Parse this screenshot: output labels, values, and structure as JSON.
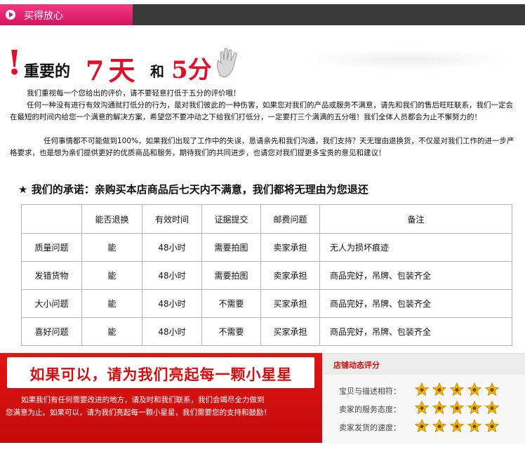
{
  "header": {
    "tab_label": "买得放心"
  },
  "title": {
    "exclaim": "!",
    "part1": "重要的",
    "part2": "7天",
    "part3": "和",
    "part4": "5分"
  },
  "paragraphs": {
    "p1": "我们重视每一个您给出的评价，请不要轻意打低于五分的评价哦！",
    "p2": "任何一种没有进行有效沟通就打低分的行为，是对我们彼此的一种伤害，如果您对我们的产品或服务不满意，请先和我们的售后旺旺联系，我们一定会在最短的时间内给您一个满意的解决方案，希望您不要冲动之下给我们打低分，一定要打三个满满的五分哦！我们全体人员都会为止不懈努力的！",
    "p3": "任何事情都不可能做到100%，如果我们出现了工作中的失误，恳请亲先和我们沟通，我们支持？天无理由退换货，不仅是对我们工作的进一步严格要求，也是想为亲们提供更好的优质商品和服务，期待我们的共同进步，也请您对我们提更多宝贵的意见和建议！"
  },
  "promise": {
    "star": "★",
    "text": "我们的承诺：亲购买本店商品后七天内不满意，我们都将无理由为您退还"
  },
  "table": {
    "headers": [
      "",
      "能否退换",
      "有效时间",
      "证据提交",
      "邮费问题",
      "备注"
    ],
    "rows": [
      [
        "质量问题",
        "能",
        "48小时",
        "需要拍图",
        "卖家承担",
        "无人为损坏痕迹"
      ],
      [
        "发错货物",
        "能",
        "48小时",
        "需要拍图",
        "卖家承担",
        "商品完好，吊牌、包装齐全"
      ],
      [
        "大小问题",
        "能",
        "48小时",
        "不需要",
        "买家承担",
        "商品完好，吊牌、包装齐全"
      ],
      [
        "喜好问题",
        "能",
        "48小时",
        "不需要",
        "买家承担",
        "商品完好，吊牌、包装齐全"
      ]
    ]
  },
  "star_appeal": {
    "headline": "如果可以，请为我们亮起每一颗小星星",
    "line1": "如果我们有任何需要改进的地方，请及时和我们联系，我们会竭尽全力做到",
    "line2": "您满意为止。如果可以，请为我们亮起每一颗小星星，我们需要您的支持和鼓励！"
  },
  "rating": {
    "title": "店铺动态评分",
    "items": [
      {
        "label": "宝贝与描述相符：",
        "stars": 5
      },
      {
        "label": "卖家的服务态度：",
        "stars": 5
      },
      {
        "label": "卖家发货的速度：",
        "stars": 5
      }
    ]
  },
  "colors": {
    "accent": "#e31e6e",
    "red": "#d40d0d",
    "star": "#f5b800"
  }
}
